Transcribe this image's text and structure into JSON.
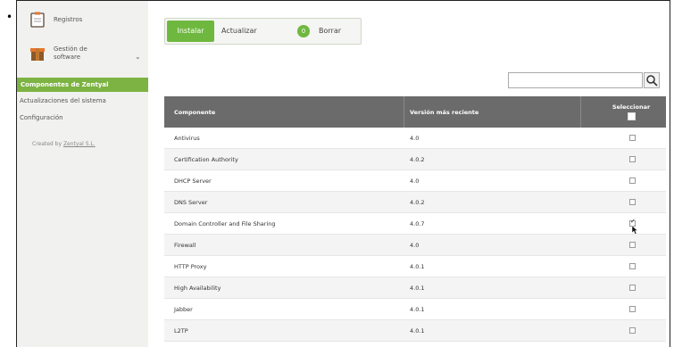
{
  "sidebar": {
    "items": [
      {
        "label": "Registros",
        "icon": "clipboard-icon"
      },
      {
        "label": "Gestión de software",
        "line1": "Gestión de",
        "line2": "software",
        "icon": "package-icon"
      }
    ],
    "submenu": {
      "active": "Componentes de Zentyal",
      "items": [
        "Actualizaciones del sistema",
        "Configuración"
      ]
    },
    "created_by_prefix": "Created by",
    "created_by_link": "Zentyal S.L."
  },
  "toolbar": {
    "install_label": "Instalar",
    "update_label": "Actualizar",
    "update_count": "0",
    "delete_label": "Borrar"
  },
  "search": {
    "value": "",
    "button_icon": "search-icon"
  },
  "table": {
    "headers": {
      "component": "Componente",
      "version": "Versión más reciente",
      "select": "Seleccionar"
    },
    "rows": [
      {
        "name": "Antivirus",
        "version": "4.0",
        "checked": false
      },
      {
        "name": "Certification Authority",
        "version": "4.0.2",
        "checked": false
      },
      {
        "name": "DHCP Server",
        "version": "4.0",
        "checked": false
      },
      {
        "name": "DNS Server",
        "version": "4.0.2",
        "checked": false
      },
      {
        "name": "Domain Controller and File Sharing",
        "version": "4.0.7",
        "checked": true
      },
      {
        "name": "Firewall",
        "version": "4.0",
        "checked": false
      },
      {
        "name": "HTTP Proxy",
        "version": "4.0.1",
        "checked": false
      },
      {
        "name": "High Availability",
        "version": "4.0.1",
        "checked": false
      },
      {
        "name": "Jabber",
        "version": "4.0.1",
        "checked": false
      },
      {
        "name": "L2TP",
        "version": "4.0.1",
        "checked": false
      }
    ]
  },
  "colors": {
    "accent": "#6fb83f",
    "active_menu": "#7cb342",
    "table_header": "#6b6b6b"
  }
}
